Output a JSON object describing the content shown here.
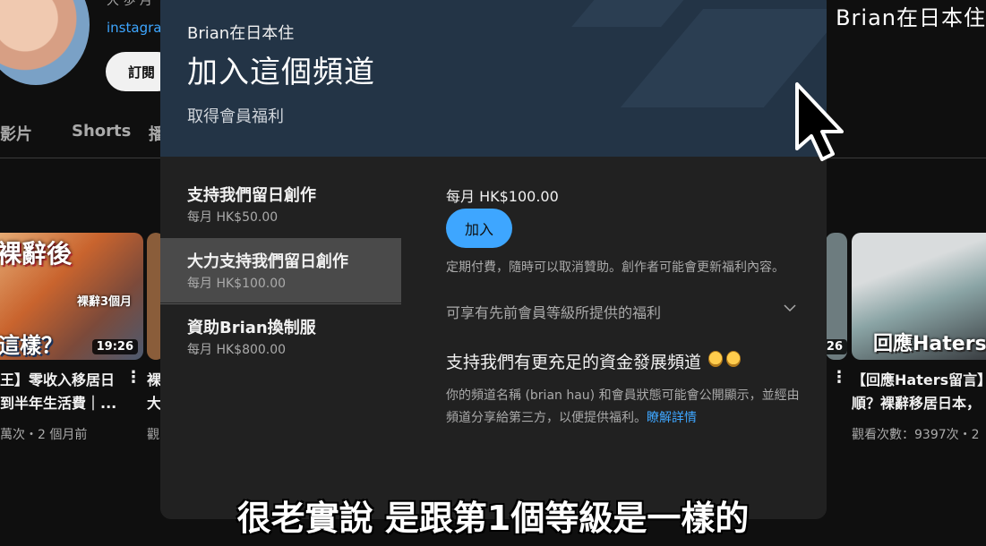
{
  "channel": {
    "handle_partial": "大 歩 月",
    "link_partial": "instagra",
    "subscribe_label": "訂閱",
    "tabs": [
      "影片",
      "Shorts",
      "播"
    ]
  },
  "videos": [
    {
      "thumb_text": "裸辭後",
      "thumb_tag": "裸辭3個月",
      "thumb_question": "這樣？",
      "duration": "19:26",
      "title_line1": "王】零收入移居日",
      "title_line2": "到半年生活費｜...",
      "meta": "萬次・2 個月前"
    },
    {
      "title_line1": "裸",
      "title_line2": "大",
      "meta": "觀"
    },
    {
      "thumb_text": "回應Haters",
      "duration_partial": "26",
      "title_line1": "【回應Haters留言】",
      "title_line2": "順？裸辭移居日本，",
      "meta": "觀看次數：9397次・2"
    }
  ],
  "overlay": {
    "channel_name": "Brian在日本住"
  },
  "dialog": {
    "channel_name": "Brian在日本住",
    "title": "加入這個頻道",
    "subtitle": "取得會員福利",
    "tiers": [
      {
        "name": "支持我們留日創作",
        "price": "每月 HK$50.00",
        "selected": false
      },
      {
        "name": "大力支持我們留日創作",
        "price": "每月 HK$100.00",
        "selected": true
      },
      {
        "name": "資助Brian換制服",
        "price": "每月 HK$800.00",
        "selected": false
      }
    ],
    "detail": {
      "price": "每月 HK$100.00",
      "join_label": "加入",
      "fine_print": "定期付費，隨時可以取消贊助。創作者可能會更新福利內容。",
      "perks_label": "可享有先前會員等級所提供的福利",
      "support_title": "支持我們有更充足的資金發展頻道",
      "privacy_text": "你的頻道名稱 (brian hau) 和會員狀態可能會公開顯示，並經由頻道分享給第三方，以便提供福利。",
      "learn_more": "瞭解詳情"
    }
  },
  "caption": "很老實說 是跟第1個等級是一樣的",
  "colors": {
    "accent": "#3ea6ff",
    "header_bg": "#233446",
    "dialog_bg": "#212121",
    "page_bg": "#0f0f0f"
  }
}
